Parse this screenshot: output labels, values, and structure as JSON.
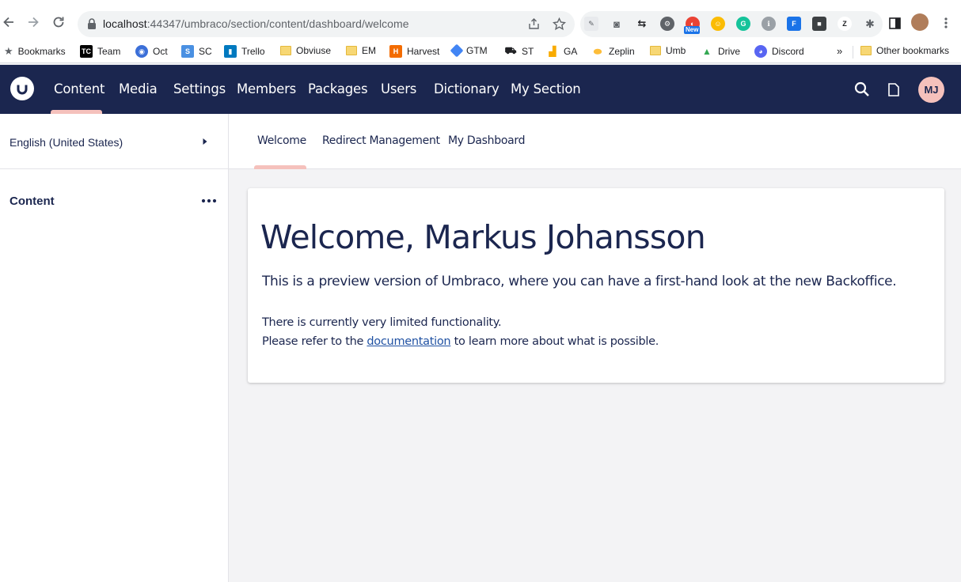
{
  "browser": {
    "url_host": "localhost",
    "url_rest": ":44347/umbraco/section/content/dashboard/welcome",
    "new_badge": "New",
    "other_bookmarks": "Other bookmarks",
    "overflow": "»",
    "bookmarks": [
      {
        "label": "Bookmarks"
      },
      {
        "label": "Team",
        "icon_text": "TC",
        "color": "#000000"
      },
      {
        "label": "Oct",
        "color": "#3b6fd8"
      },
      {
        "label": "SC",
        "color": "#4a90e2"
      },
      {
        "label": "Trello",
        "color": "#0079bf"
      },
      {
        "label": "Obviuse"
      },
      {
        "label": "EM"
      },
      {
        "label": "Harvest",
        "color": "#f36c00"
      },
      {
        "label": "GTM",
        "color": "#4285f4"
      },
      {
        "label": "ST"
      },
      {
        "label": "GA",
        "color": "#f9ab00"
      },
      {
        "label": "Zeplin",
        "color": "#fdbd39"
      },
      {
        "label": "Umb"
      },
      {
        "label": "Drive"
      },
      {
        "label": "Discord",
        "color": "#5865f2"
      }
    ]
  },
  "header": {
    "nav": [
      "Content",
      "Media",
      "Settings",
      "Members",
      "Packages",
      "Users",
      "Dictionary",
      "My Section"
    ],
    "avatar_initials": "MJ"
  },
  "sidebar": {
    "language": "English (United States)",
    "tree_title": "Content"
  },
  "tabs": [
    "Welcome",
    "Redirect Management",
    "My Dashboard"
  ],
  "welcome": {
    "title": "Welcome, Markus Johansson",
    "lead": "This is a preview version of Umbraco, where you can have a first-hand look at the new Backoffice.",
    "line1": "There is currently very limited functionality.",
    "line2_prefix": "Please refer to the ",
    "link_text": "documentation",
    "line2_suffix": " to learn more about what is possible."
  },
  "colors": {
    "header_bg": "#1b264f",
    "accent": "#f5c1bc",
    "text": "#1b264f",
    "link": "#2152a3"
  }
}
